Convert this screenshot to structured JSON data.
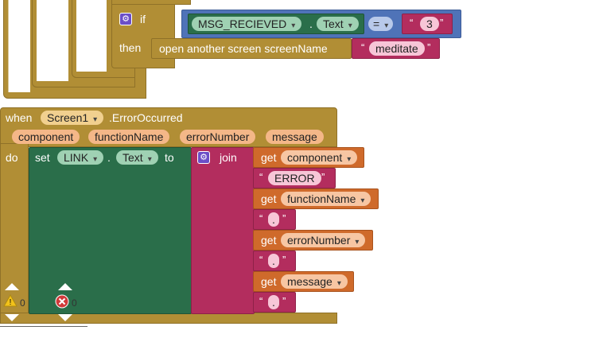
{
  "if_block": {
    "if_label": "if",
    "then_label": "then",
    "component": "MSG_RECIEVED",
    "dot": ".",
    "property": "Text",
    "operator": "=",
    "value": "3",
    "open_screen_label": "open another screen  screenName",
    "screen_name": "meditate"
  },
  "event": {
    "when_label": "when",
    "component": "Screen1",
    "event_name": ".ErrorOccurred",
    "params": [
      "component",
      "functionName",
      "errorNumber",
      "message"
    ],
    "do_label": "do"
  },
  "set_block": {
    "set_label": "set",
    "component": "LINK",
    "dot": ".",
    "property": "Text",
    "to_label": "to"
  },
  "join_block": {
    "join_label": "join",
    "get_label": "get",
    "items": {
      "get_component": "component",
      "error_text": "ERROR",
      "get_functionName": "functionName",
      "sep1": ".",
      "get_errorNumber": "errorNumber",
      "sep2": ".",
      "get_message": "message",
      "sep3": "."
    }
  },
  "workspace": {
    "warning_count": "0",
    "error_count": "0"
  },
  "colors": {
    "control": "#b18e35",
    "component": "#2a6e4a",
    "text": "#b32d5e",
    "procedure": "#cf6a2b",
    "logic": "#4f73b8"
  },
  "icons": [
    "gear-icon",
    "warning-icon",
    "error-icon",
    "chevron-up-icon",
    "chevron-down-icon"
  ]
}
